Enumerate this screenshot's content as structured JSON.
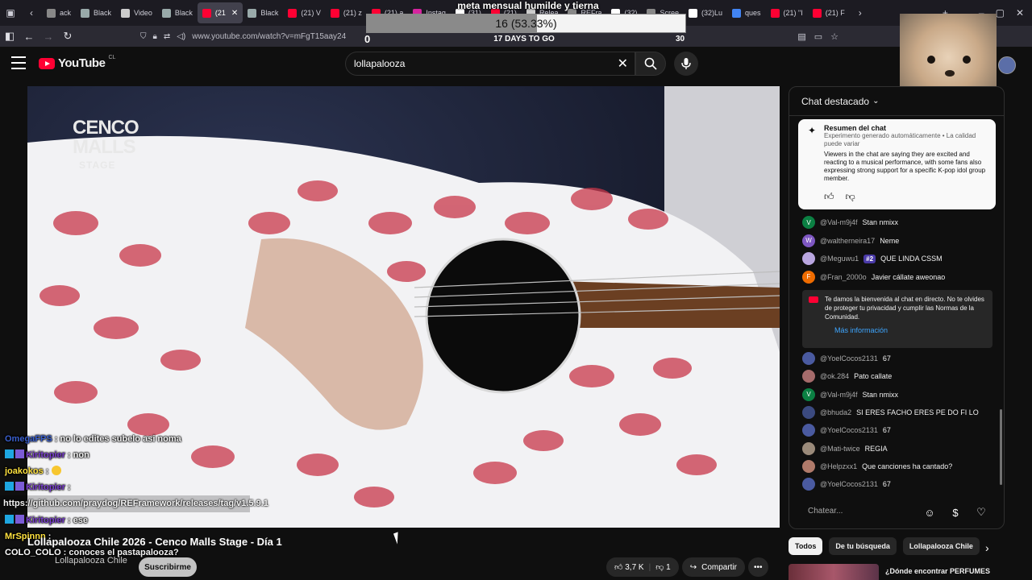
{
  "browser": {
    "tabs": [
      {
        "label": "ack",
        "color": "#888"
      },
      {
        "label": "Black",
        "color": "#9aa"
      },
      {
        "label": "Video",
        "color": "#ccc"
      },
      {
        "label": "Black",
        "color": "#9aa"
      },
      {
        "label": "(21",
        "color": "#ff0033",
        "active": true
      },
      {
        "label": "Black",
        "color": "#9aa"
      },
      {
        "label": "(21) V",
        "color": "#ff0033"
      },
      {
        "label": "(21) z",
        "color": "#ff0033"
      },
      {
        "label": "(21) a",
        "color": "#ff0033"
      },
      {
        "label": "Instag",
        "color": "#d6249f"
      },
      {
        "label": "(31)",
        "color": "#fff"
      },
      {
        "label": "(21)",
        "color": "#ff0033"
      },
      {
        "label": "Relea",
        "color": "#ccc"
      },
      {
        "label": "REFra",
        "color": "#888"
      },
      {
        "label": "(32)",
        "color": "#fff"
      },
      {
        "label": "Scree",
        "color": "#888"
      },
      {
        "label": "(32)Lu",
        "color": "#fff"
      },
      {
        "label": "ques",
        "color": "#4285f4"
      },
      {
        "label": "(21) \"I",
        "color": "#ff0033"
      },
      {
        "label": "(21) F",
        "color": "#ff0033"
      }
    ],
    "url": "www.youtube.com/watch?v=mFgT15aay24"
  },
  "goal": {
    "title": "meta mensual humilde y tierna",
    "percent_text": "16 (53.33%)",
    "progress": 0.5333,
    "min": "0",
    "max": "30",
    "days_left": "17 DAYS TO GO"
  },
  "youtube": {
    "logo_text": "YouTube",
    "country": "CL",
    "search_value": "lollapalooza"
  },
  "video": {
    "stage_line1": "CENCO",
    "stage_line2": "MALLS",
    "stage_line3": "STAGE",
    "title_main": "Lollapalooza Chile 2026 - Cenco Malls Stage - ",
    "title_day": "Día 1",
    "channel": "Lollapalooza Chile",
    "subscribe": "Suscribirme",
    "likes": "3,7 K",
    "dislikes": "1",
    "share": "Compartir"
  },
  "overlay_chat": [
    {
      "user": "OmegaFPS",
      "color": "#3a5fcd",
      "text": ": no lo edites subelo asi noma",
      "badges": 0
    },
    {
      "user": "Kiritopier",
      "color": "#7b3fd0",
      "text": ": non",
      "badges": 2
    },
    {
      "user": "joakokos",
      "color": "#ffe23f",
      "text": ":",
      "badges": 0,
      "emote": true
    },
    {
      "user": "Kiritopier",
      "color": "#7b3fd0",
      "text": ":",
      "badges": 2
    },
    {
      "user": "Kiritopier",
      "color": "#7b3fd0",
      "text": ": ese",
      "badges": 2
    },
    {
      "user": "MrSpinnn",
      "color": "#ffe23f",
      "text": ":",
      "badges": 0
    },
    {
      "user": "COLO_COLO",
      "color": "#ffffff",
      "text": ": conoces el pastapalooza?",
      "badges": 0
    }
  ],
  "overlay_link": "https://github.com/praydog/REFramework/releases/tag/v1.5.9.1",
  "chat": {
    "header": "Chat destacado",
    "summary_title": "Resumen del chat",
    "summary_note": "Experimento generado automáticamente • La calidad puede variar",
    "summary_body": "Viewers in the chat are saying they are excited and reacting to a musical performance, with some fans also expressing strong support for a specific K-pop idol group member.",
    "messages_top": [
      {
        "initial": "V",
        "color": "#0b8043",
        "author": "@Val-m9j4f",
        "text": "Stan nmixx"
      },
      {
        "initial": "W",
        "color": "#7e57c2",
        "author": "@waltherneira17",
        "text": "Neme"
      },
      {
        "initial": "",
        "color": "#b9a6e0",
        "author": "@Meguwu1",
        "rank": "#2",
        "text": "QUE LINDA CSSM"
      },
      {
        "initial": "F",
        "color": "#ef6c00",
        "author": "@Fran_2000o",
        "text": "Javier cállate aweonao"
      }
    ],
    "welcome_text": "Te damos la bienvenida al chat en directo. No te olvides de proteger tu privacidad y cumplir las Normas de la Comunidad.",
    "welcome_link": "Más información",
    "messages_bottom": [
      {
        "initial": "",
        "color": "#4a5aa0",
        "author": "@YoelCocos2131",
        "text": "67"
      },
      {
        "initial": "",
        "color": "#a56b6b",
        "author": "@ok.284",
        "text": "Pato callate"
      },
      {
        "initial": "V",
        "color": "#0b8043",
        "author": "@Val-m9j4f",
        "text": "Stan nmixx"
      },
      {
        "initial": "",
        "color": "#3b4a80",
        "author": "@bhuda2",
        "text": "SI ERES FACHO ERES PE DO FI LO"
      },
      {
        "initial": "",
        "color": "#4a5aa0",
        "author": "@YoelCocos2131",
        "text": "67"
      },
      {
        "initial": "",
        "color": "#9a8a7a",
        "author": "@Mati-twice",
        "text": "REGIA"
      },
      {
        "initial": "",
        "color": "#b07a6a",
        "author": "@Helpzxx1",
        "text": "Que canciones ha cantado?"
      },
      {
        "initial": "",
        "color": "#4a5aa0",
        "author": "@YoelCocos2131",
        "text": "67"
      }
    ],
    "input_placeholder": "Chatear..."
  },
  "chips": [
    "Todos",
    "De tu búsqueda",
    "Lollapalooza Chile"
  ],
  "recommendation_title": "¿Dónde encontrar PERFUMES"
}
